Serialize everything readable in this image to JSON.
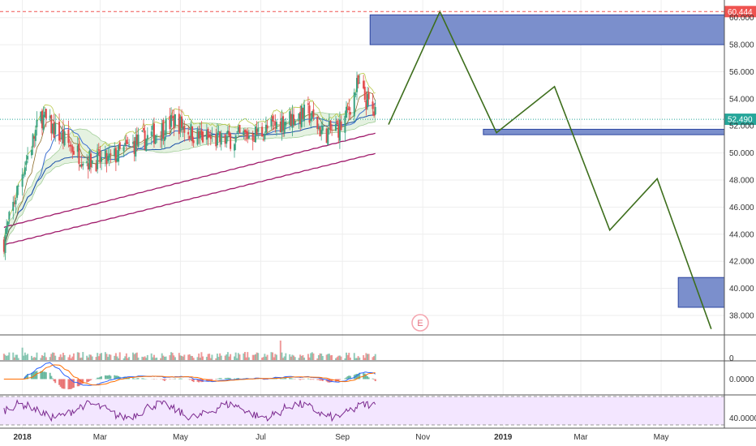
{
  "chart_data": {
    "type": "line",
    "title": "",
    "xlabel": "",
    "ylabel": "",
    "x_ticks": [
      "2018",
      "Mar",
      "May",
      "Jul",
      "Sep",
      "Nov",
      "2019",
      "Mar",
      "May"
    ],
    "x_year_ticks": [
      "2018",
      "2019"
    ],
    "y_ticks": [
      "38.000",
      "40.000",
      "42.000",
      "44.000",
      "46.000",
      "48.000",
      "50.000",
      "52.000",
      "54.000",
      "56.000",
      "58.000",
      "60.000"
    ],
    "ylim": [
      36.8,
      61.0
    ],
    "last_price": "52.490",
    "high_price": "60.444",
    "event_marker": "E",
    "projection": {
      "name": "",
      "points": [
        [
          "2018-10-06",
          52.1
        ],
        [
          "2018-11-14",
          60.44
        ],
        [
          "2018-12-27",
          51.5
        ],
        [
          "2019-02-09",
          54.9
        ],
        [
          "2019-03-23",
          44.3
        ],
        [
          "2019-04-28",
          48.1
        ],
        [
          "2019-06-08",
          37.0
        ]
      ]
    },
    "zones": [
      {
        "from": "2018-09-22",
        "to": "2019-06-18",
        "top": 60.2,
        "bottom": 58.0
      },
      {
        "from": "2018-12-17",
        "to": "2019-06-18",
        "top": 51.75,
        "bottom": 51.35
      },
      {
        "from": "2019-05-14",
        "to": "2019-06-18",
        "top": 40.8,
        "bottom": 38.6
      }
    ],
    "price_series_range": {
      "from": "2017-12-18",
      "to": "2018-09-26"
    },
    "volume_pane": {
      "y_ticks": [
        "0"
      ]
    },
    "macd_pane": {
      "y_ticks": [
        "0.0000"
      ]
    },
    "rsi_pane": {
      "y_ticks": [
        "40.0000"
      ]
    },
    "grid": true,
    "legend": "none"
  },
  "colors": {
    "projection": "#3d6e1c",
    "zone_fill": "#7b8fcc",
    "zone_border": "#2b44a0",
    "candle_up": "#3aa382",
    "candle_down": "#e24a4a",
    "last_price_badge": "#26a69a",
    "high_price_badge": "#ef5350",
    "ma_long": "#a01b6b",
    "rsi_bg": "#f3e6ff",
    "rsi_line": "#7b2a8f"
  }
}
